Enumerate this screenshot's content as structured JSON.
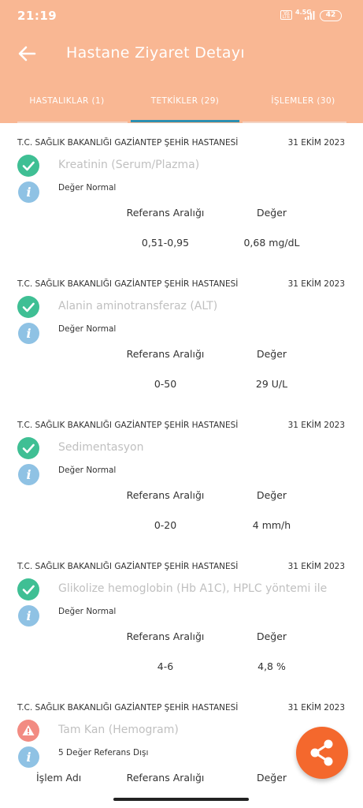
{
  "status_bar": {
    "time": "21:19",
    "signal_label": "Vo LTE",
    "network": "4.5G",
    "battery": "42"
  },
  "header": {
    "title": "Hastane Ziyaret Detayı",
    "back_icon": "arrow-left-icon"
  },
  "tabs": [
    {
      "label": "HASTALIKLAR (1)",
      "active": false
    },
    {
      "label": "TETKİKLER (29)",
      "active": true
    },
    {
      "label": "İŞLEMLER (30)",
      "active": false
    }
  ],
  "colors": {
    "header_bg": "#f9b793",
    "tab_indicator": "#2d8fb0",
    "ok_icon": "#3fbf94",
    "warn_icon": "#f28b82",
    "info_icon": "#8fc2e4",
    "fab": "#f4682d"
  },
  "tests": [
    {
      "hospital": "T.C. SAĞLIK BAKANLIĞI GAZİANTEP ŞEHİR HASTANESİ",
      "date": "31 EKİM 2023",
      "name": "Kreatinin (Serum/Plazma)",
      "status_icon": "check-icon",
      "status_text": "Değer Normal",
      "ref_header": "Referans Aralığı",
      "value_header": "Değer",
      "ref_range": "0,51-0,95",
      "value": "0,68 mg/dL"
    },
    {
      "hospital": "T.C. SAĞLIK BAKANLIĞI GAZİANTEP ŞEHİR HASTANESİ",
      "date": "31 EKİM 2023",
      "name": "Alanin aminotransferaz (ALT)",
      "status_icon": "check-icon",
      "status_text": "Değer Normal",
      "ref_header": "Referans Aralığı",
      "value_header": "Değer",
      "ref_range": "0-50",
      "value": "29 U/L"
    },
    {
      "hospital": "T.C. SAĞLIK BAKANLIĞI GAZİANTEP ŞEHİR HASTANESİ",
      "date": "31 EKİM 2023",
      "name": "Sedimentasyon",
      "status_icon": "check-icon",
      "status_text": "Değer Normal",
      "ref_header": "Referans Aralığı",
      "value_header": "Değer",
      "ref_range": "0-20",
      "value": "4 mm/h"
    },
    {
      "hospital": "T.C. SAĞLIK BAKANLIĞI GAZİANTEP ŞEHİR HASTANESİ",
      "date": "31 EKİM 2023",
      "name": "Glikolize hemoglobin (Hb A1C), HPLC yöntemi ile",
      "status_icon": "check-icon",
      "status_text": "Değer Normal",
      "ref_header": "Referans Aralığı",
      "value_header": "Değer",
      "ref_range": "4-6",
      "value": "4,8 %"
    },
    {
      "hospital": "T.C. SAĞLIK BAKANLIĞI GAZİANTEP ŞEHİR HASTANESİ",
      "date": "31 EKİM 2023",
      "name": "Tam Kan (Hemogram)",
      "status_icon": "warning-icon",
      "status_text": "5 Değer Referans Dışı",
      "name_header": "İşlem Adı",
      "ref_header": "Referans Aralığı",
      "value_header": "Değer"
    }
  ],
  "fab": {
    "icon": "share-icon"
  }
}
